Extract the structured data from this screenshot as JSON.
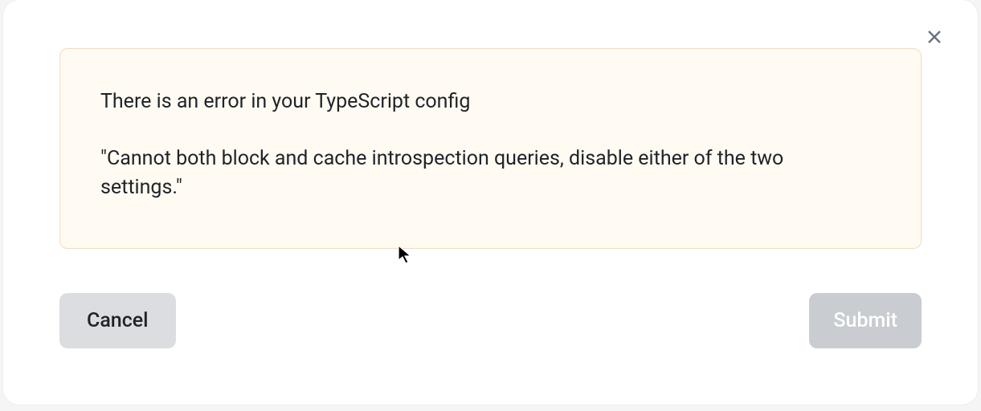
{
  "alert": {
    "line1": "There is an error in your TypeScript config",
    "line2": "\"Cannot both block and cache introspection queries, disable either of the two settings.\""
  },
  "buttons": {
    "cancel": "Cancel",
    "submit": "Submit"
  }
}
